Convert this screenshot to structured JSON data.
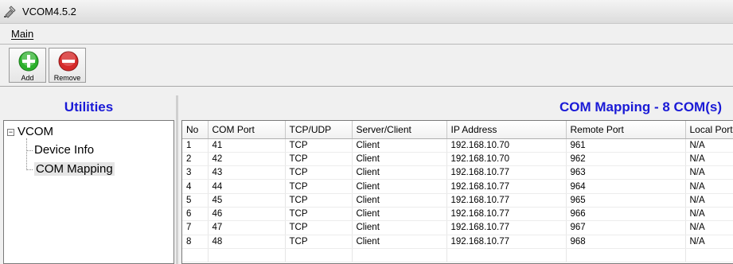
{
  "window": {
    "title": "VCOM4.5.2"
  },
  "menu": {
    "main_label": "Main"
  },
  "toolbar": {
    "add_label": "Add",
    "remove_label": "Remove"
  },
  "left_panel": {
    "title": "Utilities",
    "tree": {
      "root": "VCOM",
      "children": [
        "Device Info",
        "COM Mapping"
      ],
      "selected": "COM Mapping"
    }
  },
  "right_panel": {
    "title": "COM Mapping - 8 COM(s)",
    "columns": [
      "No",
      "COM Port",
      "TCP/UDP",
      "Server/Client",
      "IP Address",
      "Remote Port",
      "Local Port"
    ],
    "rows": [
      [
        "1",
        "41",
        "TCP",
        "Client",
        "192.168.10.70",
        "961",
        "N/A"
      ],
      [
        "2",
        "42",
        "TCP",
        "Client",
        "192.168.10.70",
        "962",
        "N/A"
      ],
      [
        "3",
        "43",
        "TCP",
        "Client",
        "192.168.10.77",
        "963",
        "N/A"
      ],
      [
        "4",
        "44",
        "TCP",
        "Client",
        "192.168.10.77",
        "964",
        "N/A"
      ],
      [
        "5",
        "45",
        "TCP",
        "Client",
        "192.168.10.77",
        "965",
        "N/A"
      ],
      [
        "6",
        "46",
        "TCP",
        "Client",
        "192.168.10.77",
        "966",
        "N/A"
      ],
      [
        "7",
        "47",
        "TCP",
        "Client",
        "192.168.10.77",
        "967",
        "N/A"
      ],
      [
        "8",
        "48",
        "TCP",
        "Client",
        "192.168.10.77",
        "968",
        "N/A"
      ]
    ]
  },
  "colors": {
    "heading_blue": "#1a1ad6",
    "add_green": "#2bb02b",
    "remove_red": "#d62a2a"
  },
  "icons": [
    "app-icon",
    "add-icon",
    "remove-icon",
    "tree-expand-icon"
  ]
}
